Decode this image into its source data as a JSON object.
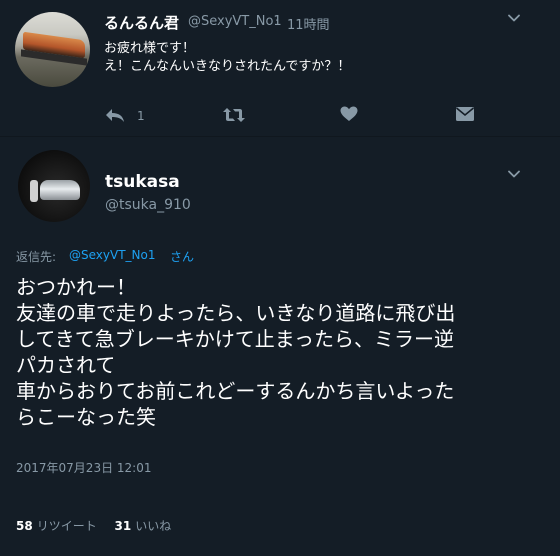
{
  "tweet1": {
    "display_name": "るんるん君",
    "handle": "@SexyVT_No1",
    "dot": "·",
    "time": "11時間",
    "lines": [
      "お疲れ様です！",
      "え！こんなんいきなりされたんですか？！"
    ],
    "reply_count": "1",
    "icons": [
      "reply-icon",
      "retweet-icon",
      "like-icon",
      "dm-icon",
      "chevron-down-icon"
    ]
  },
  "tweet2": {
    "display_name": "tsukasa",
    "handle": "@tsuka_910",
    "reply_label": "返信先:",
    "reply_handle": "@SexyVT_No1",
    "reply_suffix": "さん",
    "text": "おつかれー！\n友達の車で走りよったら、いきなり道路に飛び出\nしてきて急ブレーキかけて止まったら、ミラー逆\nパカされて\n車からおりてお前これどーするんかち言いよった\nらこーなった笑",
    "date": "2017年07月23日 12:01",
    "retweet_count": "58",
    "retweet_label": "リツイート",
    "like_count": "31",
    "like_label": "いいね"
  },
  "colors": {
    "background": "#141d26",
    "secondary_text": "#8899a6",
    "link": "#1da1f2"
  }
}
